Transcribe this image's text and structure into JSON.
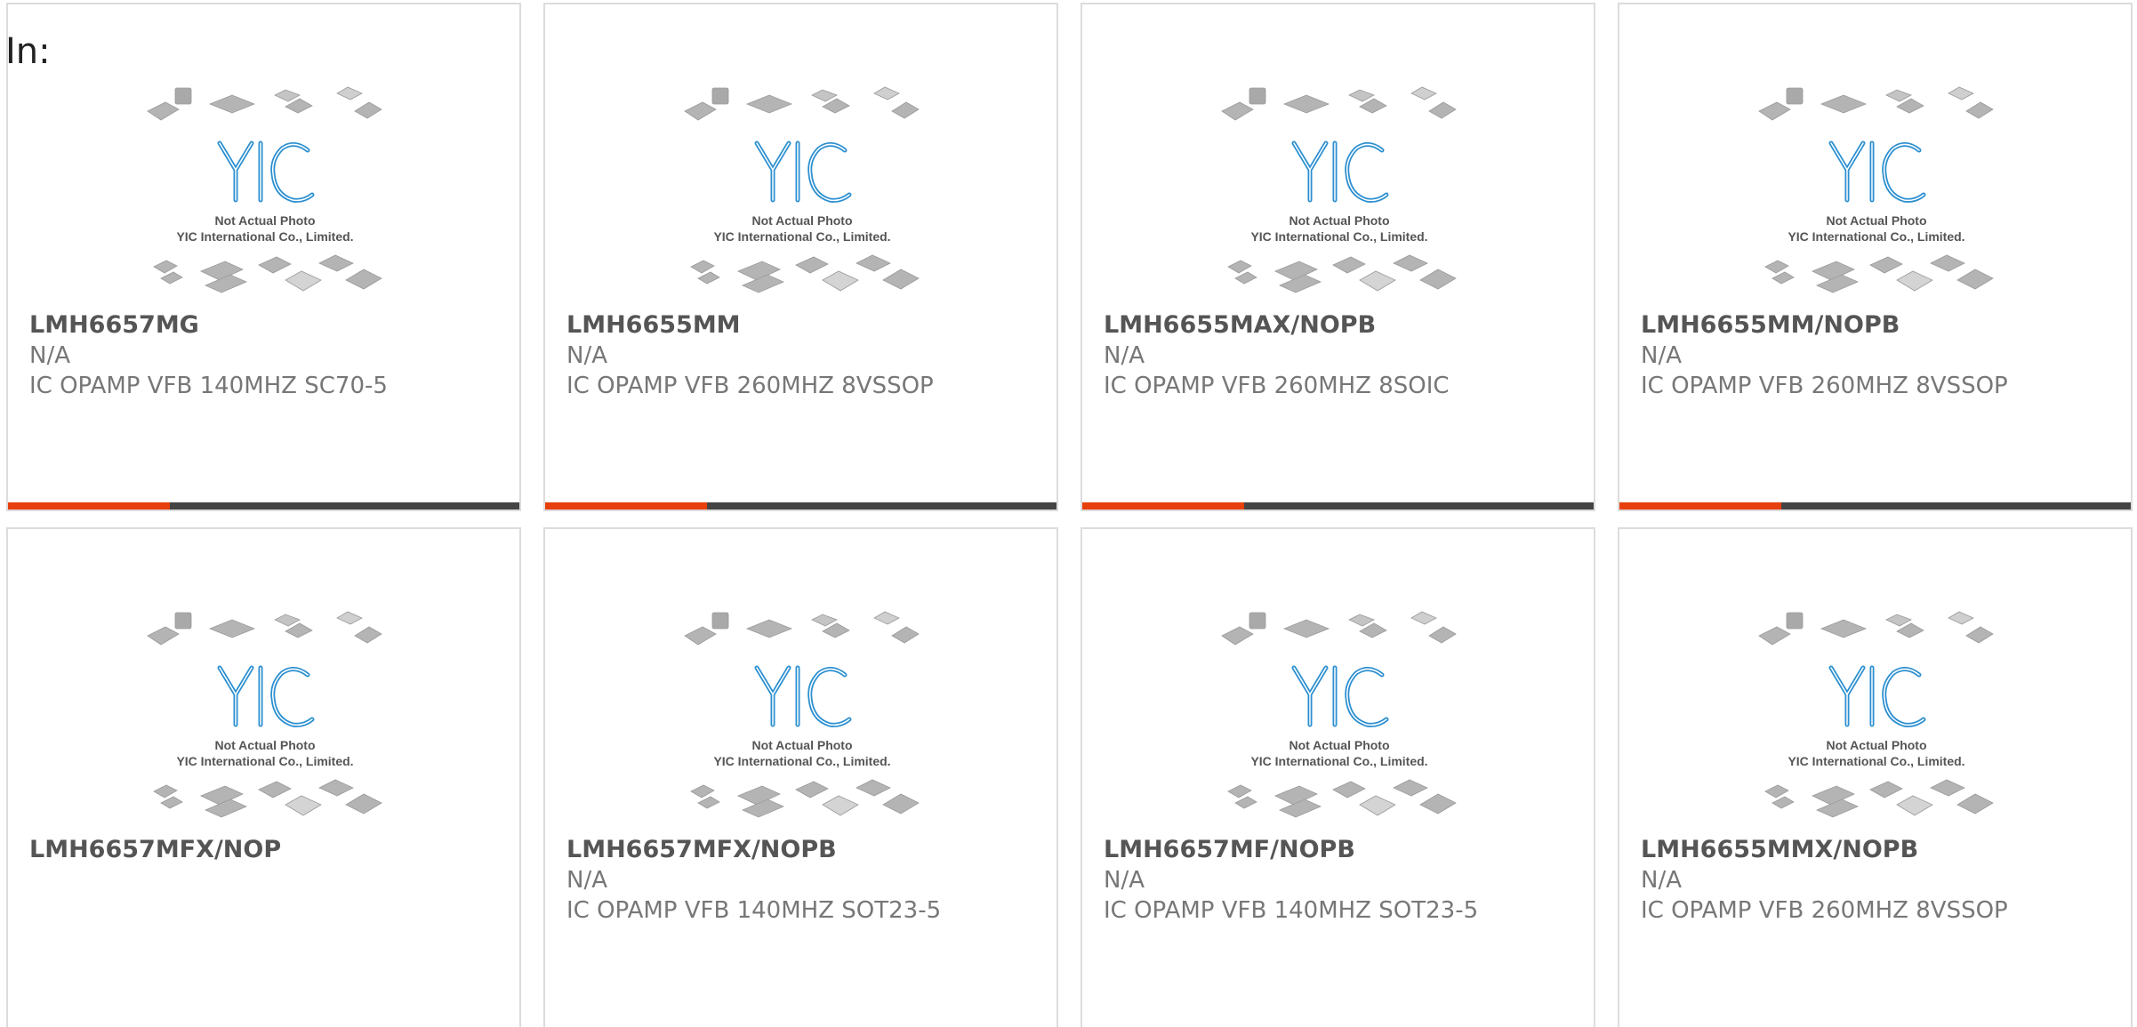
{
  "header": {
    "label": "In:"
  },
  "colors": {
    "accent": "#e8400c",
    "bar_dark": "#444444",
    "logo_blue": "#2b8fd0"
  },
  "placeholder": {
    "line1": "Not Actual Photo",
    "line2": "YIC International Co., Limited."
  },
  "products": [
    {
      "part": "LMH6657MG",
      "manufacturer": "N/A",
      "description": "IC OPAMP VFB 140MHZ SC70-5",
      "progress_bar": true
    },
    {
      "part": "LMH6655MM",
      "manufacturer": "N/A",
      "description": "IC OPAMP VFB 260MHZ 8VSSOP",
      "progress_bar": true
    },
    {
      "part": "LMH6655MAX/NOPB",
      "manufacturer": "N/A",
      "description": "IC OPAMP VFB 260MHZ 8SOIC",
      "progress_bar": true
    },
    {
      "part": "LMH6655MM/NOPB",
      "manufacturer": "N/A",
      "description": "IC OPAMP VFB 260MHZ 8VSSOP",
      "progress_bar": true
    },
    {
      "part": "LMH6657MFX/NOP",
      "manufacturer": "",
      "description": "",
      "progress_bar": false
    },
    {
      "part": "LMH6657MFX/NOPB",
      "manufacturer": "N/A",
      "description": "IC OPAMP VFB 140MHZ SOT23-5",
      "progress_bar": false
    },
    {
      "part": "LMH6657MF/NOPB",
      "manufacturer": "N/A",
      "description": "IC OPAMP VFB 140MHZ SOT23-5",
      "progress_bar": false
    },
    {
      "part": "LMH6655MMX/NOPB",
      "manufacturer": "N/A",
      "description": "IC OPAMP VFB 260MHZ 8VSSOP",
      "progress_bar": false
    }
  ]
}
